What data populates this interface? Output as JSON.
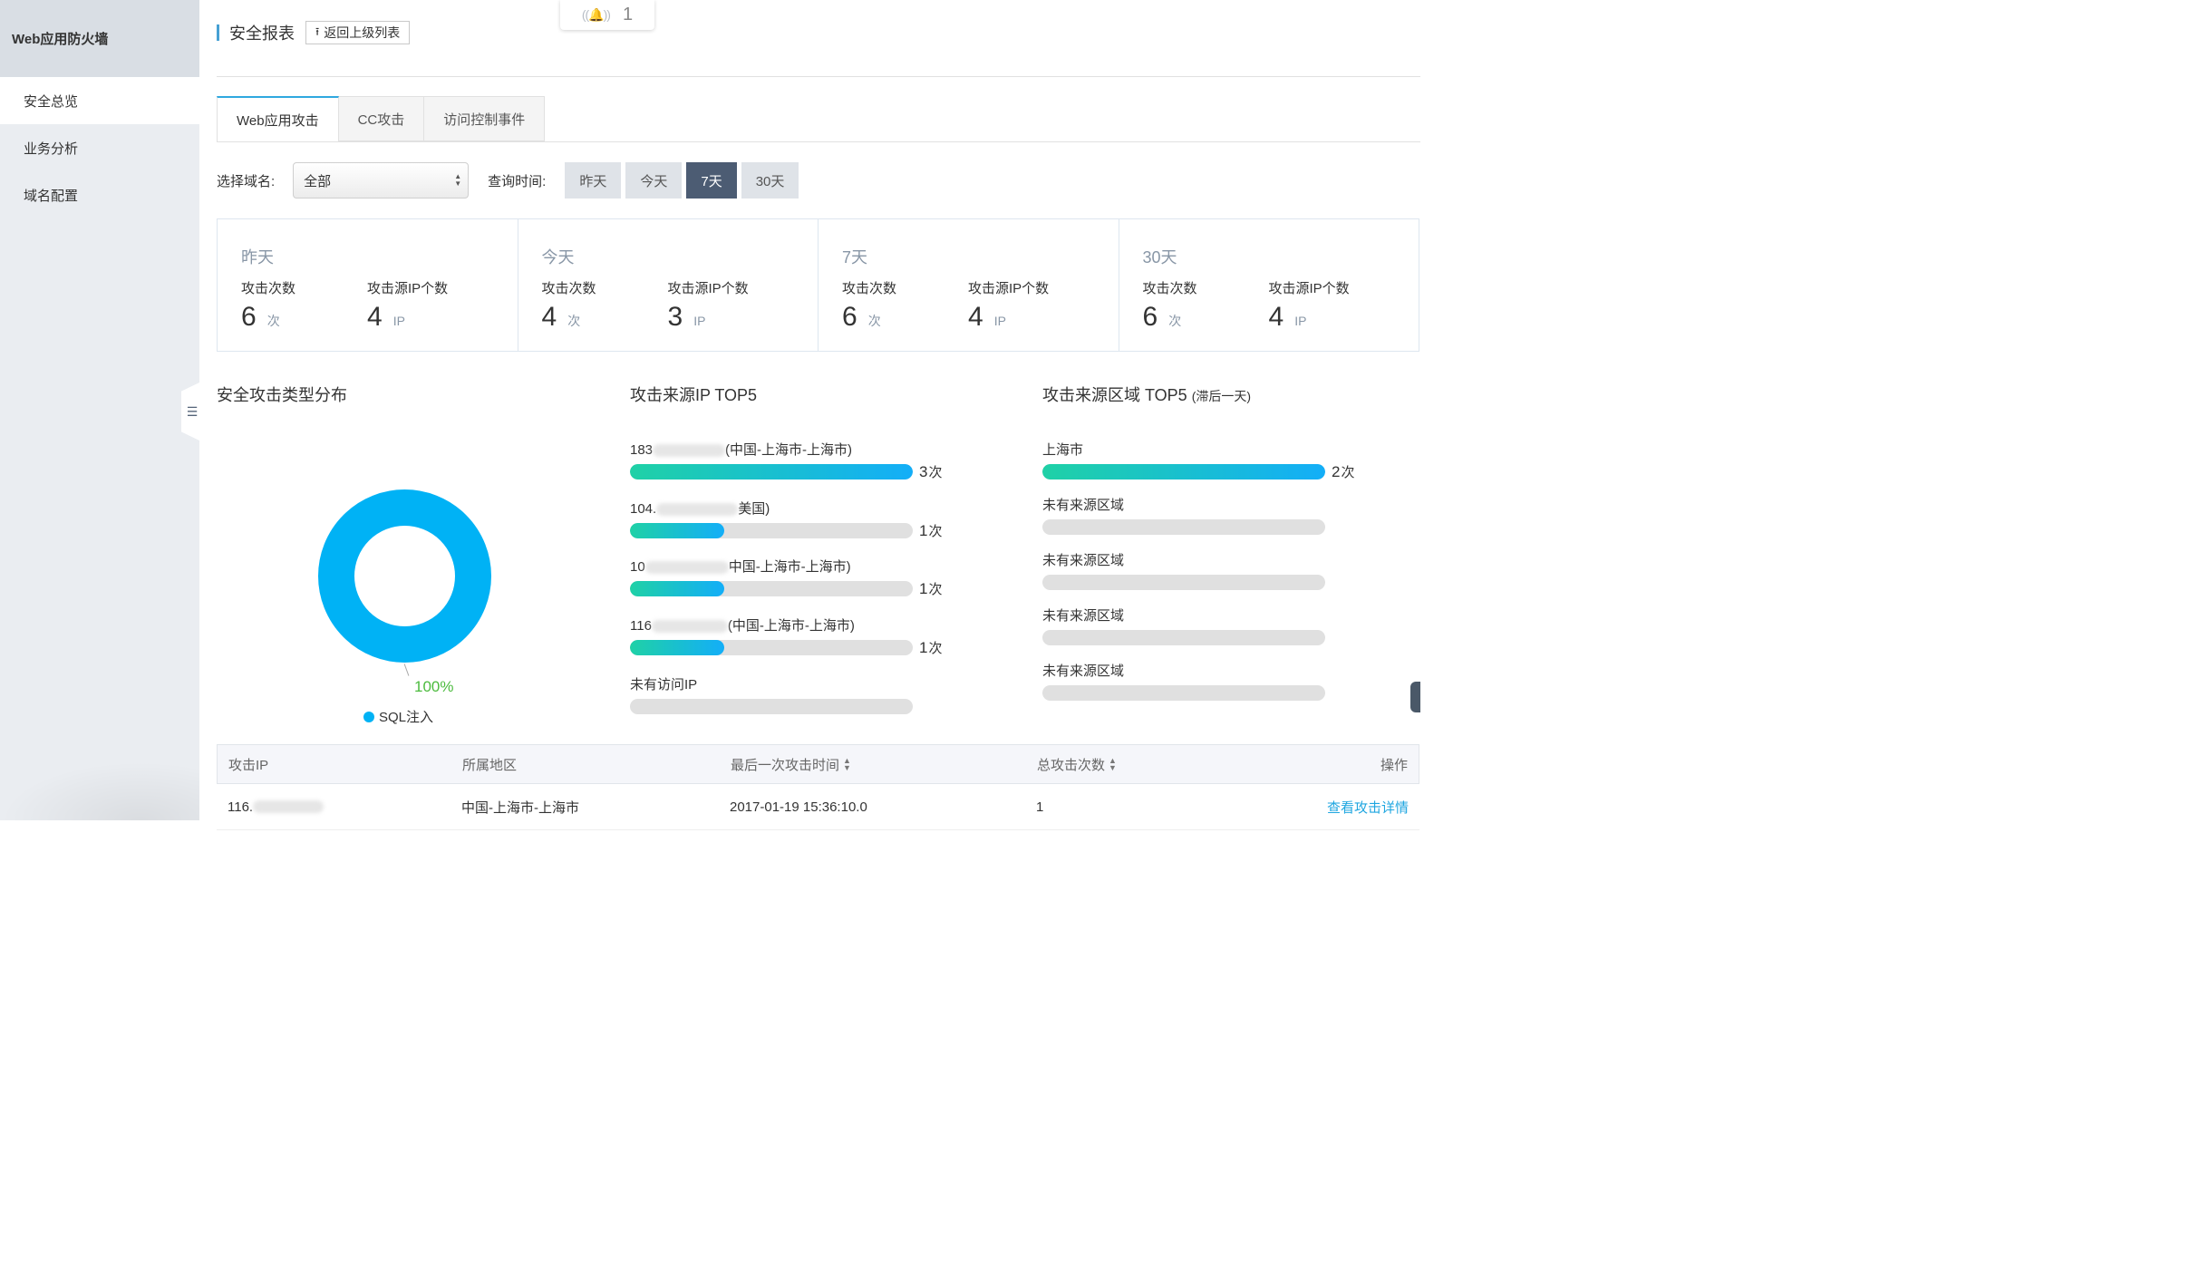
{
  "sidebar": {
    "title": "Web应用防火墙",
    "items": [
      {
        "label": "安全总览",
        "active": true
      },
      {
        "label": "业务分析",
        "active": false
      },
      {
        "label": "域名配置",
        "active": false
      }
    ],
    "collapse_icon": "outdent-icon"
  },
  "header": {
    "title": "安全报表",
    "back_label": "返回上级列表",
    "back_icon": "upload-arrow-icon"
  },
  "notification": {
    "icon": "bell-icon",
    "count": "1"
  },
  "tabs": [
    {
      "label": "Web应用攻击",
      "active": true
    },
    {
      "label": "CC攻击",
      "active": false
    },
    {
      "label": "访问控制事件",
      "active": false
    }
  ],
  "filter": {
    "domain_label": "选择域名:",
    "domain_value": "全部",
    "time_label": "查询时间:",
    "time_options": [
      {
        "label": "昨天",
        "active": false
      },
      {
        "label": "今天",
        "active": false
      },
      {
        "label": "7天",
        "active": true
      },
      {
        "label": "30天",
        "active": false
      }
    ]
  },
  "stats": [
    {
      "period": "昨天",
      "attack_label": "攻击次数",
      "attack_count": "6",
      "attack_unit": "次",
      "ip_label": "攻击源IP个数",
      "ip_count": "4",
      "ip_unit": "IP"
    },
    {
      "period": "今天",
      "attack_label": "攻击次数",
      "attack_count": "4",
      "attack_unit": "次",
      "ip_label": "攻击源IP个数",
      "ip_count": "3",
      "ip_unit": "IP"
    },
    {
      "period": "7天",
      "attack_label": "攻击次数",
      "attack_count": "6",
      "attack_unit": "次",
      "ip_label": "攻击源IP个数",
      "ip_count": "4",
      "ip_unit": "IP"
    },
    {
      "period": "30天",
      "attack_label": "攻击次数",
      "attack_count": "6",
      "attack_unit": "次",
      "ip_label": "攻击源IP个数",
      "ip_count": "4",
      "ip_unit": "IP"
    }
  ],
  "attack_types": {
    "title": "安全攻击类型分布",
    "slices": [
      {
        "name": "SQL注入",
        "percent": 100,
        "label": "100%",
        "color": "#00b2f5"
      }
    ]
  },
  "ip_top5": {
    "title": "攻击来源IP TOP5",
    "unit": "次",
    "max": 3,
    "items": [
      {
        "prefix": "183",
        "suffix": "(中国-上海市-上海市)",
        "count": 3
      },
      {
        "prefix": "104.",
        "suffix": "美国)",
        "count": 1
      },
      {
        "prefix": "10",
        "suffix": "中国-上海市-上海市)",
        "count": 1
      },
      {
        "prefix": "116",
        "suffix": "(中国-上海市-上海市)",
        "count": 1
      },
      {
        "prefix": "未有访问IP",
        "suffix": "",
        "count": null
      }
    ]
  },
  "region_top5": {
    "title": "攻击来源区域 TOP5",
    "subtitle": "(滞后一天)",
    "unit": "次",
    "max": 2,
    "items": [
      {
        "label": "上海市",
        "count": 2
      },
      {
        "label": "未有来源区域",
        "count": null
      },
      {
        "label": "未有来源区域",
        "count": null
      },
      {
        "label": "未有来源区域",
        "count": null
      },
      {
        "label": "未有来源区域",
        "count": null
      }
    ]
  },
  "table": {
    "columns": [
      "攻击IP",
      "所属地区",
      "最后一次攻击时间",
      "总攻击次数",
      "操作"
    ],
    "rows": [
      {
        "ip": "116.",
        "region": "中国-上海市-上海市",
        "last_time": "2017-01-19 15:36:10.0",
        "total": "1",
        "action": "查看攻击详情"
      }
    ]
  },
  "colors": {
    "accent": "#2fa8df",
    "active_time_button": "#4c5c73",
    "bar_gradient_start": "#1fd1a6",
    "bar_gradient_end": "#13aef8",
    "percent_label": "#4cbb3e"
  }
}
